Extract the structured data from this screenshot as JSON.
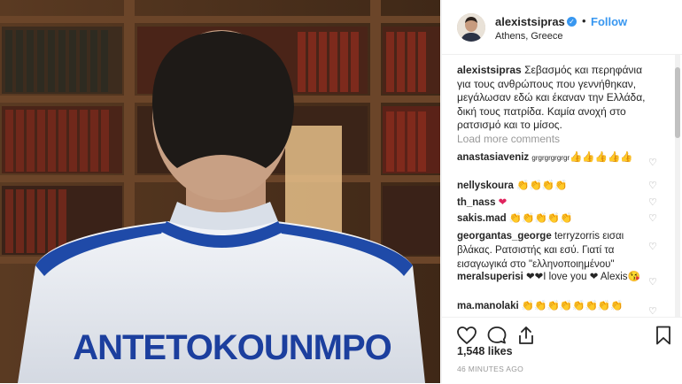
{
  "post": {
    "username": "alexistsipras",
    "verified_badge": "✓",
    "separator": "•",
    "follow_label": "Follow",
    "location": "Athens, Greece",
    "caption_user": "alexistsipras",
    "caption_text": "Σεβασμός και περηφάνια για τους ανθρώπους που γεννήθηκαν, μεγάλωσαν εδώ και έκαναν την Ελλάδα, δική τους πατρίδα. Καμία ανοχή στο ρατσισμό και το μίσος.",
    "load_more": "Load more comments",
    "jersey_text": "ANTETOKOUNMPO"
  },
  "comments": [
    {
      "user": "anastasiaveniz",
      "text_prefix": "grgrgrgrgrgr",
      "text": "👍👍👍👍👍"
    },
    {
      "user": "nellyskoura",
      "text": "👏👏👏👏"
    },
    {
      "user": "th_nass",
      "text": "❤"
    },
    {
      "user": "sakis.mad",
      "text": "👏👏👏👏👏"
    },
    {
      "user": "georgantas_george",
      "text": "terryzorris εισαι βλάκας. Ρατσιστής και εσύ. Γιατί τα εισαγωγικά στο \"ελληνοποιημένου\""
    },
    {
      "user": "meralsuperisi",
      "text": "❤❤I love you ❤ Alexis😘"
    },
    {
      "user": "ma.manolaki",
      "text": "👏👏👏👏👏👏👏👏"
    }
  ],
  "actions": {
    "likes": "1,548 likes",
    "time_ago": "46 MINUTES AGO"
  },
  "icons": {
    "heart": "heart-icon",
    "comment": "comment-icon",
    "share": "share-icon",
    "bookmark": "bookmark-icon",
    "comment_like": "♡"
  },
  "colors": {
    "accent": "#3897f0",
    "muted": "#999999",
    "text": "#262626"
  }
}
